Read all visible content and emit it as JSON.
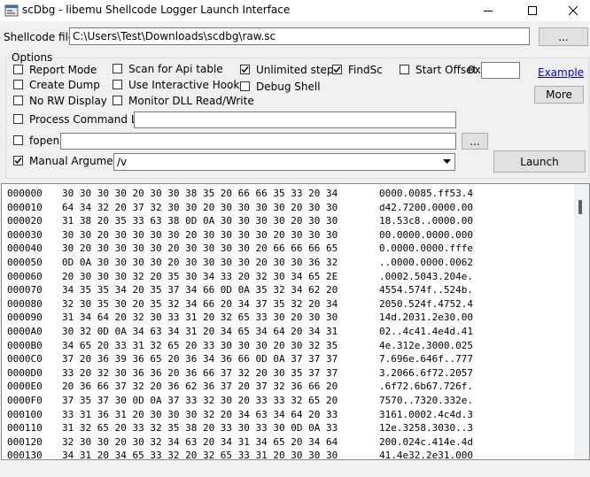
{
  "window": {
    "title": "scDbg - libemu Shellcode Logger Launch Interface"
  },
  "shellcode": {
    "label": "Shellcode file",
    "path": "C:\\Users\\Test\\Downloads\\scdbg\\raw.sc",
    "browse_label": "..."
  },
  "options": {
    "group_label": "Options",
    "report_mode": "Report Mode",
    "create_dump": "Create Dump",
    "no_rw_display": "No RW Display",
    "scan_api": "Scan for Api table",
    "interactive_hooks": "Use Interactive Hooks",
    "monitor_dll": "Monitor DLL Read/Write",
    "unlimited_steps": "Unlimited steps",
    "debug_shell": "Debug Shell",
    "findsc": "FindSc",
    "start_offset": "Start Offset",
    "offset_prefix": "0x",
    "offset_value": "",
    "example_link": "Example",
    "more_label": "More",
    "process_cmdline": "Process Command Line",
    "process_cmdline_value": "",
    "fopen": "fopen",
    "fopen_value": "",
    "fopen_browse": "...",
    "manual_args": "Manual  Arguments",
    "manual_args_value": "/v",
    "launch_label": "Launch"
  },
  "hexdump": [
    {
      "offset": "000000",
      "hex": "30 30 30 30 20 30 30 38 35 20 66 66 35 33 20 34",
      "ascii": "0000.0085.ff53.4"
    },
    {
      "offset": "000010",
      "hex": "64 34 32 20 37 32 30 30 20 30 30 30 30 20 30 30",
      "ascii": "d42.7200.0000.00"
    },
    {
      "offset": "000020",
      "hex": "31 38 20 35 33 63 38 0D 0A 30 30 30 30 20 30 30",
      "ascii": "18.53c8..0000.00"
    },
    {
      "offset": "000030",
      "hex": "30 30 20 30 30 30 30 20 30 30 30 30 20 30 30 30",
      "ascii": "00.0000.0000.000"
    },
    {
      "offset": "000040",
      "hex": "30 20 30 30 30 30 20 30 30 30 30 20 66 66 66 65",
      "ascii": "0.0000.0000.fffe"
    },
    {
      "offset": "000050",
      "hex": "0D 0A 30 30 30 30 20 30 30 30 30 20 30 30 36 32",
      "ascii": "..0000.0000.0062"
    },
    {
      "offset": "000060",
      "hex": "20 30 30 30 32 20 35 30 34 33 20 32 30 34 65 2E",
      "ascii": ".0002.5043.204e."
    },
    {
      "offset": "000070",
      "hex": "34 35 35 34 20 35 37 34 66 0D 0A 35 32 34 62 20",
      "ascii": "4554.574f..524b."
    },
    {
      "offset": "000080",
      "hex": "32 30 35 30 20 35 32 34 66 20 34 37 35 32 20 34",
      "ascii": "2050.524f.4752.4"
    },
    {
      "offset": "000090",
      "hex": "31 34 64 20 32 30 33 31 20 32 65 33 30 20 30 30",
      "ascii": "14d.2031.2e30.00"
    },
    {
      "offset": "0000A0",
      "hex": "30 32 0D 0A 34 63 34 31 20 34 65 34 64 20 34 31",
      "ascii": "02..4c41.4e4d.41"
    },
    {
      "offset": "0000B0",
      "hex": "34 65 20 33 31 32 65 20 33 30 30 30 20 30 32 35",
      "ascii": "4e.312e.3000.025"
    },
    {
      "offset": "0000C0",
      "hex": "37 20 36 39 36 65 20 36 34 36 66 0D 0A 37 37 37",
      "ascii": "7.696e.646f..777"
    },
    {
      "offset": "0000D0",
      "hex": "33 20 32 30 36 36 20 36 66 37 32 20 30 35 37 37",
      "ascii": "3.2066.6f72.2057"
    },
    {
      "offset": "0000E0",
      "hex": "20 36 66 37 32 20 36 62 36 37 20 37 32 36 66 20",
      "ascii": ".6f72.6b67.726f."
    },
    {
      "offset": "0000F0",
      "hex": "37 35 37 30 0D 0A 37 33 32 30 20 33 33 32 65 20",
      "ascii": "7570..7320.332e."
    },
    {
      "offset": "000100",
      "hex": "33 31 36 31 20 30 30 30 32 20 34 63 34 64 20 33",
      "ascii": "3161.0002.4c4d.3"
    },
    {
      "offset": "000110",
      "hex": "31 32 65 20 33 32 35 38 20 33 30 33 30 0D 0A 33",
      "ascii": "12e.3258.3030..3"
    },
    {
      "offset": "000120",
      "hex": "32 30 30 20 30 32 34 63 20 34 31 34 65 20 34 64",
      "ascii": "200.024c.414e.4d"
    },
    {
      "offset": "000130",
      "hex": "34 31 20 34 65 33 32 20 32 65 33 31 20 30 30 30",
      "ascii": "41.4e32.2e31.000"
    }
  ]
}
